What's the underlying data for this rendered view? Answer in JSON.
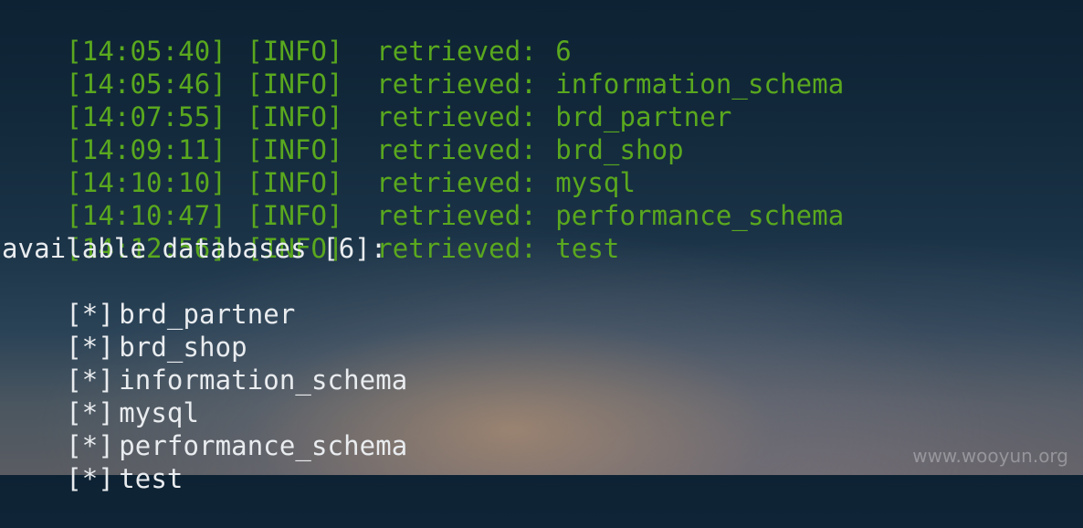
{
  "terminal": {
    "log_lines": [
      {
        "time": "[14:05:40]",
        "level": "[INFO]",
        "message": "retrieved:",
        "value": "6"
      },
      {
        "time": "[14:05:46]",
        "level": "[INFO]",
        "message": "retrieved:",
        "value": "information_schema"
      },
      {
        "time": "[14:07:55]",
        "level": "[INFO]",
        "message": "retrieved:",
        "value": "brd_partner"
      },
      {
        "time": "[14:09:11]",
        "level": "[INFO]",
        "message": "retrieved:",
        "value": "brd_shop"
      },
      {
        "time": "[14:10:10]",
        "level": "[INFO]",
        "message": "retrieved:",
        "value": "mysql"
      },
      {
        "time": "[14:10:47]",
        "level": "[INFO]",
        "message": "retrieved:",
        "value": "performance_schema"
      },
      {
        "time": "[14:12:56]",
        "level": "[INFO]",
        "message": "retrieved:",
        "value": "test"
      }
    ],
    "summary_heading": "available databases [6]:",
    "database_marker": "[*]",
    "databases": [
      "brd_partner",
      "brd_shop",
      "information_schema",
      "mysql",
      "performance_schema",
      "test"
    ]
  },
  "colors": {
    "log_text": "#5aa81e",
    "plain_text": "#e9ecef"
  },
  "watermark": "www.wooyun.org"
}
